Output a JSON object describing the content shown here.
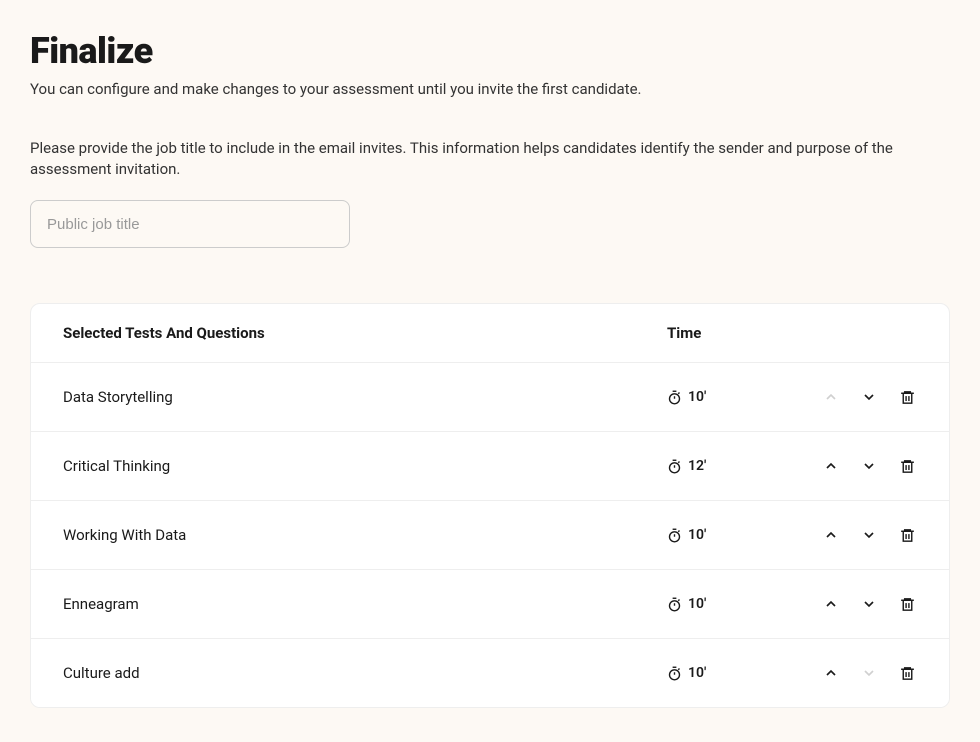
{
  "page": {
    "title": "Finalize",
    "subtitle": "You can configure and make changes to your assessment until you invite the first candidate.",
    "description": "Please provide the job title to include in the email invites. This information helps candidates identify the sender and purpose of the assessment invitation."
  },
  "jobTitleInput": {
    "placeholder": "Public job title",
    "value": ""
  },
  "table": {
    "header": {
      "name": "Selected Tests And Questions",
      "time": "Time"
    },
    "rows": [
      {
        "name": "Data Storytelling",
        "time": "10'",
        "upDisabled": true,
        "downDisabled": false
      },
      {
        "name": "Critical Thinking",
        "time": "12'",
        "upDisabled": false,
        "downDisabled": false
      },
      {
        "name": "Working With Data",
        "time": "10'",
        "upDisabled": false,
        "downDisabled": false
      },
      {
        "name": "Enneagram",
        "time": "10'",
        "upDisabled": false,
        "downDisabled": false
      },
      {
        "name": "Culture add",
        "time": "10'",
        "upDisabled": false,
        "downDisabled": true
      }
    ]
  }
}
